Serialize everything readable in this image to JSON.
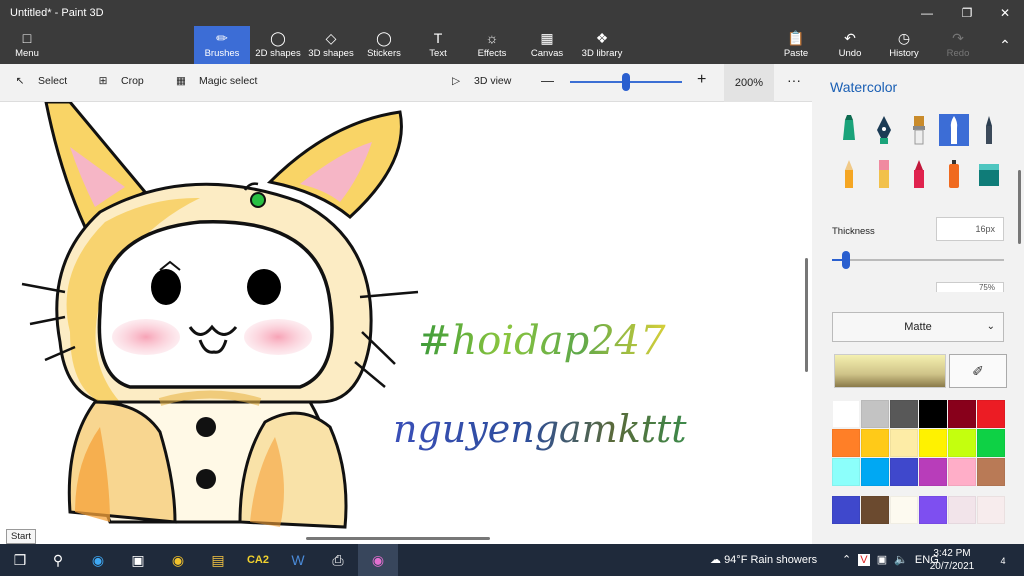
{
  "window": {
    "title": "Untitled* - Paint 3D",
    "minimize_icon": "minimize-icon",
    "maximize_icon": "restore-icon",
    "close_icon": "close-icon"
  },
  "ribbon": {
    "menu_label": "Menu",
    "tabs": [
      {
        "label": "Brushes",
        "icon": "brush-icon",
        "active": true
      },
      {
        "label": "2D shapes",
        "icon": "2d-shapes-icon"
      },
      {
        "label": "3D shapes",
        "icon": "3d-shapes-icon"
      },
      {
        "label": "Stickers",
        "icon": "stickers-icon"
      },
      {
        "label": "Text",
        "icon": "text-icon"
      },
      {
        "label": "Effects",
        "icon": "effects-icon"
      },
      {
        "label": "Canvas",
        "icon": "canvas-icon"
      },
      {
        "label": "3D library",
        "icon": "3d-library-icon"
      }
    ],
    "actions": [
      {
        "label": "Paste",
        "icon": "paste-icon"
      },
      {
        "label": "Undo",
        "icon": "undo-icon"
      },
      {
        "label": "History",
        "icon": "history-icon"
      },
      {
        "label": "Redo",
        "icon": "redo-icon",
        "disabled": true
      }
    ]
  },
  "toolbar": {
    "select_label": "Select",
    "crop_label": "Crop",
    "magic_select_label": "Magic select",
    "view_3d_label": "3D view",
    "zoom_out": "—",
    "zoom_in": "+",
    "zoom_value": "200%",
    "more": "···",
    "zoom_level": 0.5
  },
  "canvas": {
    "text_hashtag": "#hoidap247",
    "text_name": "nguyengamkttt",
    "tooltip": "Start"
  },
  "panel": {
    "title": "Watercolor",
    "brushes": [
      "marker-icon",
      "calligraphy-pen-icon",
      "oil-brush-icon",
      "watercolor-icon",
      "pixel-pen-icon",
      "pencil-icon",
      "eraser-icon",
      "crayon-icon",
      "spray-can-icon",
      "fill-icon"
    ],
    "active_brush": 3,
    "thickness_label": "Thickness",
    "thickness_value": "16px",
    "opacity_value": "75%",
    "finish": "Matte",
    "palette": [
      "#ffffff",
      "#c3c3c3",
      "#585858",
      "#000000",
      "#88001b",
      "#ec1c24",
      "#ff7f27",
      "#ffca18",
      "#fdeca6",
      "#fff200",
      "#c4ff0e",
      "#0ed145",
      "#8cfffb",
      "#00a8f3",
      "#3f48cc",
      "#b83dba",
      "#ffaec8",
      "#b97a56"
    ],
    "custom_palette": [
      "#3f48cc",
      "#6b4a2f",
      "#fdfaf0",
      "#7e4ff0",
      "#f2e4ea",
      "#f7eced"
    ]
  },
  "taskbar": {
    "apps": [
      "windows-start-icon",
      "search-icon",
      "edge-icon",
      "store-icon",
      "chrome-icon",
      "file-explorer-icon",
      "ca2-app",
      "word-icon",
      "printer-icon",
      "paint-3d-icon"
    ],
    "ca2_label": "CA2",
    "weather": "94°F  Rain showers",
    "tray": "ENG",
    "time": "3:42 PM",
    "date": "20/7/2021",
    "notifications": "4"
  }
}
